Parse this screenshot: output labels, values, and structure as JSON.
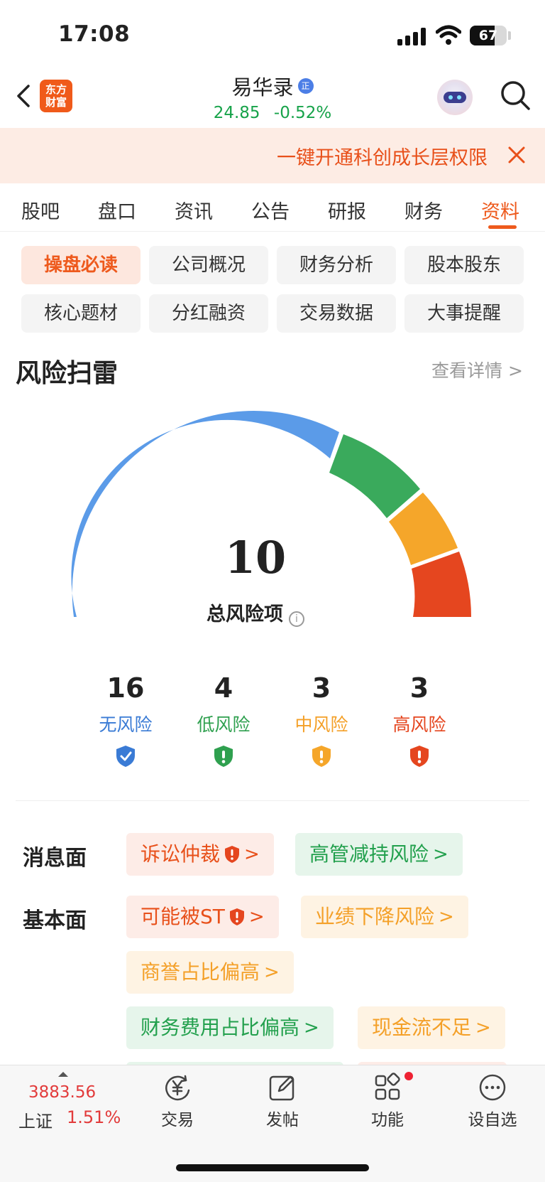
{
  "status_bar": {
    "time": "17:08",
    "battery": "67"
  },
  "header": {
    "logo_text": "东方财富",
    "stock_name": "易华录",
    "badge": "正",
    "price": "24.85",
    "change_pct": "-0.52%"
  },
  "banner": {
    "text": "一键开通科创成长层权限"
  },
  "tabs": [
    "股吧",
    "盘口",
    "资讯",
    "公告",
    "研报",
    "财务",
    "资料"
  ],
  "active_tab": "资料",
  "chips": [
    "操盘必读",
    "公司概况",
    "财务分析",
    "股本股东",
    "核心题材",
    "分红融资",
    "交易数据",
    "大事提醒"
  ],
  "section": {
    "title": "风险扫雷",
    "more": "查看详情 >"
  },
  "gauge": {
    "total": "10",
    "total_label": "总风险项",
    "info_icon": "i",
    "colors": {
      "none": "#5b9be8",
      "low": "#3aaa5c",
      "mid": "#f5a62a",
      "high": "#e5461f"
    }
  },
  "stats": [
    {
      "value": "16",
      "label": "无风险",
      "color": "#3a7bd5"
    },
    {
      "value": "4",
      "label": "低风险",
      "color": "#2fa04f"
    },
    {
      "value": "3",
      "label": "中风险",
      "color": "#f4a028"
    },
    {
      "value": "3",
      "label": "高风险",
      "color": "#e5461f"
    }
  ],
  "risk_rows": {
    "news_label": "消息面",
    "fundamental_label": "基本面",
    "tags": {
      "litigation": "诉讼仲裁",
      "exec_reduce": "高管减持风险",
      "st": "可能被ST",
      "perf_decline": "业绩下降风险",
      "goodwill": "商誉占比偏高",
      "fin_cost": "财务费用占比偏高",
      "cashflow": "现金流不足"
    },
    "arrow": ">"
  },
  "bottom_bar": {
    "index_value": "3883.56",
    "index_name": "上证",
    "index_pct": "1.51%",
    "nav": [
      "交易",
      "发帖",
      "功能",
      "设自选"
    ]
  }
}
